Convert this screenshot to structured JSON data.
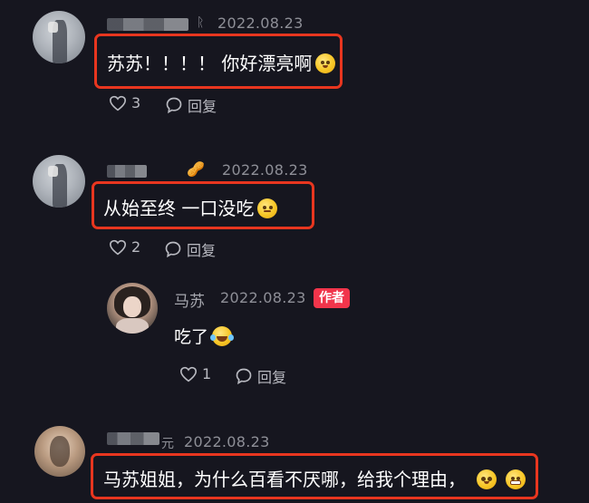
{
  "comments": [
    {
      "date": "2022.08.23",
      "text": "苏苏！！！！ 你好漂亮啊",
      "emoji_icon": "pleading-face-icon",
      "likes": "3",
      "reply_label": "回复"
    },
    {
      "date": "2022.08.23",
      "text": "从始至终 一口没吃",
      "emoji_icon": "thinking-face-icon",
      "likes": "2",
      "reply_label": "回复",
      "reply": {
        "author_name": "马苏",
        "date": "2022.08.23",
        "author_badge": "作者",
        "text": "吃了",
        "emoji_icon": "laughing-tears-icon",
        "likes": "1",
        "reply_label": "回复"
      }
    },
    {
      "name_suffix": "元",
      "date": "2022.08.23",
      "text": "马苏姐姐，为什么百看不厌哪，给我个理由，",
      "emoji_icons": [
        "flushed-face-icon",
        "grimacing-face-icon"
      ]
    }
  ],
  "colors": {
    "background": "#16161f",
    "highlight_border": "#e8361f",
    "author_badge": "#f1354b",
    "meta_text": "#8e8f97"
  }
}
